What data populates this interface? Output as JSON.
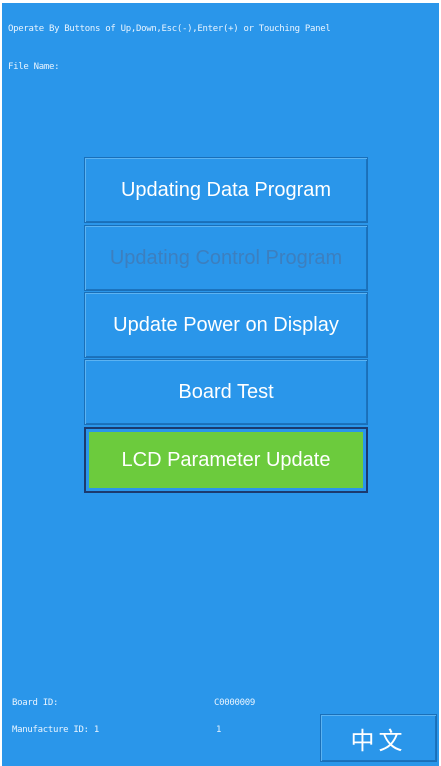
{
  "header": {
    "instruction": "Operate By Buttons of Up,Down,Esc(-),Enter(+) or Touching Panel",
    "file_name_label": "File Name:"
  },
  "menu": {
    "items": [
      {
        "label": "Updating Data Program",
        "state": "normal"
      },
      {
        "label": "Updating Control Program",
        "state": "disabled"
      },
      {
        "label": "Update Power on Display",
        "state": "normal"
      },
      {
        "label": "Board Test",
        "state": "normal"
      },
      {
        "label": "LCD Parameter Update",
        "state": "selected"
      }
    ]
  },
  "footer": {
    "board_id_label": "Board ID:",
    "board_id_value": "C0000009",
    "manufacture_id_label": "Manufacture ID: 1",
    "manufacture_id_value": "1",
    "language_button": "中文"
  },
  "colors": {
    "background": "#2a96ea",
    "selected": "#6ccb3d",
    "text": "#ffffff",
    "disabled_text": "#3c7fbf"
  }
}
